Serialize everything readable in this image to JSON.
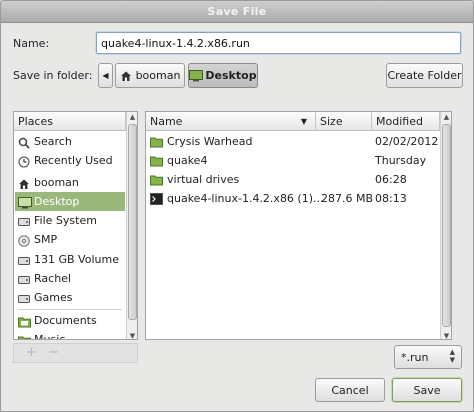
{
  "window": {
    "title": "Save File"
  },
  "name_label": "Name:",
  "name_value": "quake4-linux-1.4.2.x86.run",
  "folder_label": "Save in folder:",
  "path": {
    "back": "◀",
    "home": "booman",
    "current": "Desktop"
  },
  "create_folder": "Create Folder",
  "places": {
    "header": "Places",
    "items": [
      {
        "label": "Search",
        "icon": "search-icon"
      },
      {
        "label": "Recently Used",
        "icon": "clock-icon"
      },
      {
        "label": "booman",
        "icon": "home-icon"
      },
      {
        "label": "Desktop",
        "icon": "desktop-icon",
        "selected": true
      },
      {
        "label": "File System",
        "icon": "harddisk-icon"
      },
      {
        "label": "SMP",
        "icon": "optical-disc-icon"
      },
      {
        "label": "131 GB Volume",
        "icon": "harddisk-icon"
      },
      {
        "label": "Rachel",
        "icon": "harddisk-icon"
      },
      {
        "label": "Games",
        "icon": "harddisk-icon"
      },
      {
        "label": "Documents",
        "icon": "folder-icon"
      },
      {
        "label": "Music",
        "icon": "folder-icon"
      }
    ],
    "add": "+",
    "remove": "−"
  },
  "files": {
    "columns": {
      "name": "Name",
      "size": "Size",
      "modified": "Modified"
    },
    "rows": [
      {
        "name": "Crysis Warhead",
        "size": "",
        "modified": "02/02/2012",
        "icon": "folder-icon"
      },
      {
        "name": "quake4",
        "size": "",
        "modified": "Thursday",
        "icon": "folder-icon"
      },
      {
        "name": "virtual drives",
        "size": "",
        "modified": "06:28",
        "icon": "folder-icon"
      },
      {
        "name": "quake4-linux-1.4.2.x86 (1)...",
        "size": "287.6 MB",
        "modified": "08:13",
        "icon": "terminal-icon"
      }
    ]
  },
  "filter": {
    "value": "*.run"
  },
  "buttons": {
    "cancel": "Cancel",
    "save": "Save"
  },
  "colors": {
    "selection": "#9ab87c",
    "folder": "#86b24c"
  }
}
